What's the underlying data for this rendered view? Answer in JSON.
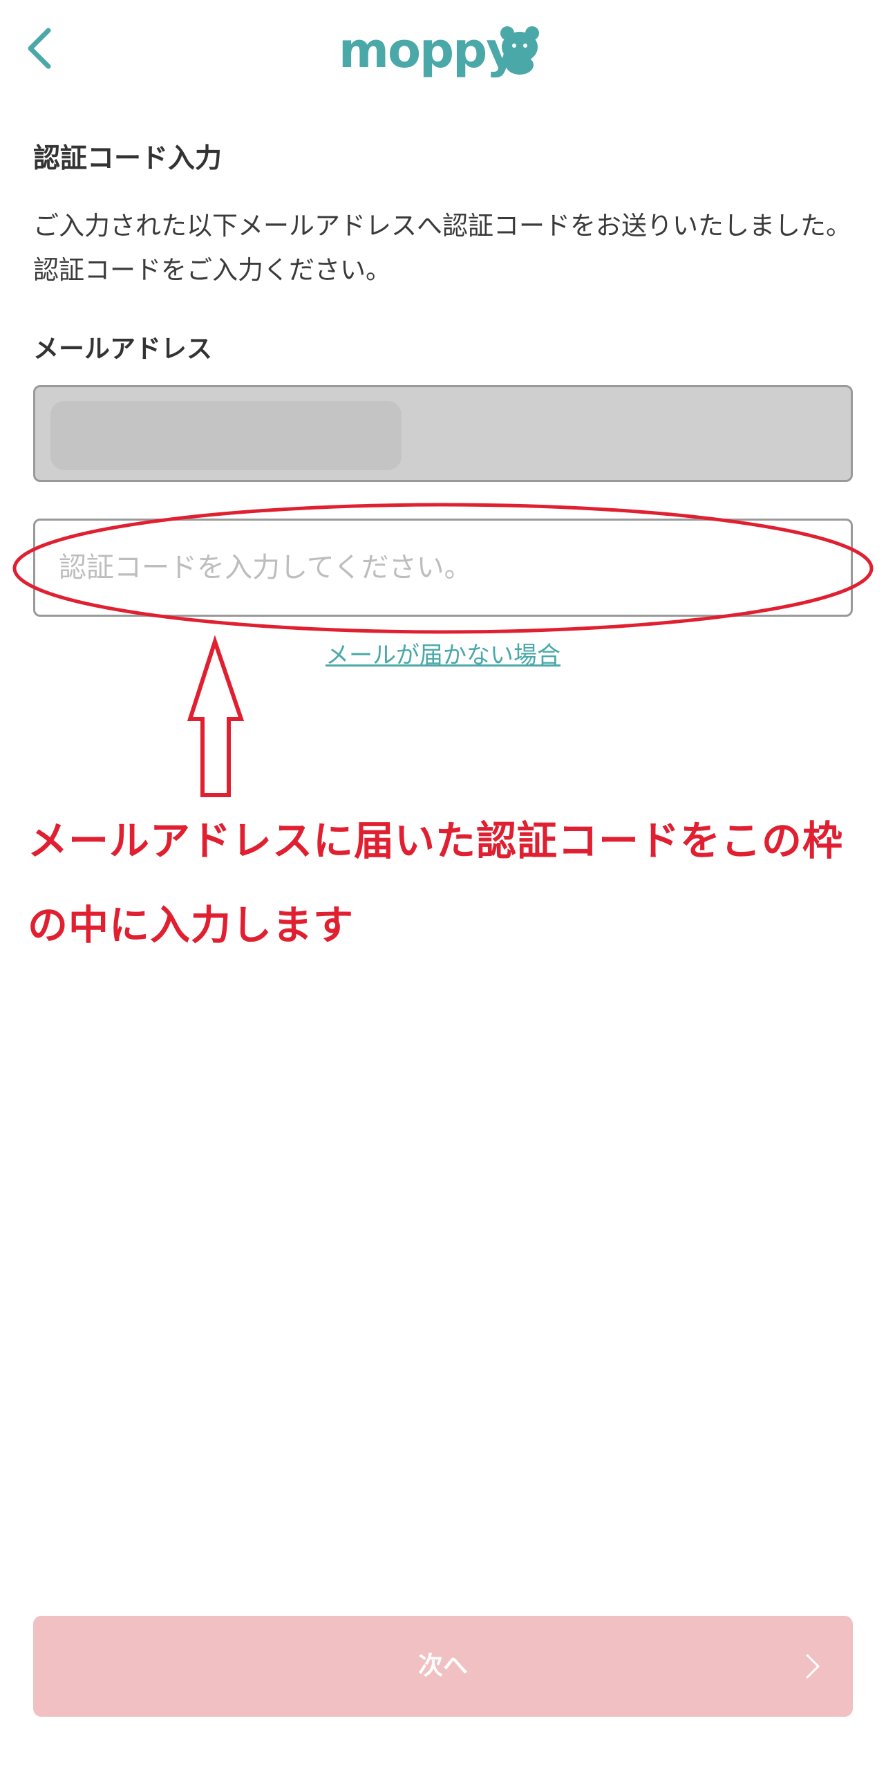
{
  "header": {
    "logo_text": "moppy",
    "back_icon": "chevron-left-icon"
  },
  "main": {
    "title": "認証コード入力",
    "description": "ご入力された以下メールアドレスへ認証コードをお送りいたしました。認証コードをご入力ください。",
    "email_label": "メールアドレス",
    "email_value": "",
    "code_placeholder": "認証コードを入力してください。",
    "code_value": "",
    "help_link": "メールが届かない場合"
  },
  "annotation": {
    "text": "メールアドレスに届いた認証コードをこの枠の中に入力します",
    "color": "#e02030"
  },
  "footer": {
    "next_label": "次へ",
    "next_icon": "chevron-right-icon"
  },
  "colors": {
    "brand": "#4aa8a8",
    "button_disabled": "#f0c0c2",
    "annotation": "#e02030",
    "email_field_bg": "#cfcfcf"
  }
}
